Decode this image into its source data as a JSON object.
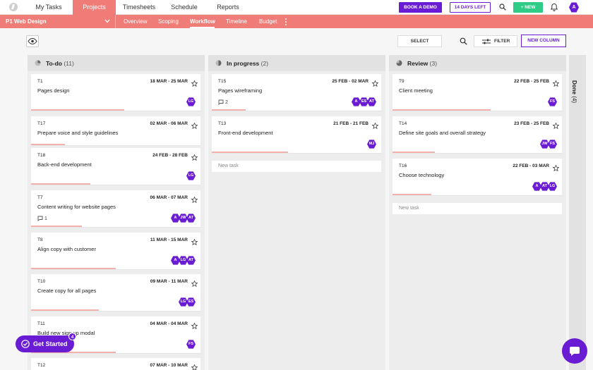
{
  "topnav": {
    "tabs": [
      "My Tasks",
      "Projects",
      "Timesheets",
      "Schedule",
      "Reports"
    ],
    "active_tab": "Projects",
    "demo_label": "BOOK A DEMO",
    "trial_label": "14 DAYS LEFT",
    "new_label": "+ NEW",
    "avatar_initial": "A"
  },
  "subnav": {
    "project_name": "P1 Web Design",
    "tabs": [
      "Overview",
      "Scoping",
      "Workflow",
      "Timeline",
      "Budget"
    ],
    "active_tab": "Workflow"
  },
  "toolbar": {
    "select_label": "SELECT",
    "filter_label": "FILTER",
    "new_column_label": "NEW COLUMN"
  },
  "colors": {
    "accent": "#6a1cd4",
    "brand_coral": "#f07c78",
    "new_green": "#2ecc87"
  },
  "columns": [
    {
      "title": "To-do",
      "count": "(11)",
      "cards": [
        {
          "id": "T1",
          "dates": "18 MAR - 25 MAR",
          "title": "Pages design",
          "comments": "",
          "avatars": [
            "LG"
          ],
          "progress": 0.55
        },
        {
          "id": "T17",
          "dates": "02 MAR - 06 MAR",
          "title": "Prepare voice and style guidelines",
          "comments": "",
          "avatars": [],
          "progress": 0.2
        },
        {
          "id": "T18",
          "dates": "24 FEB - 28 FEB",
          "title": "Back-end development",
          "comments": "",
          "avatars": [
            "LG"
          ],
          "progress": 0.35
        },
        {
          "id": "T7",
          "dates": "06 MAR - 07 MAR",
          "title": "Content writing for website pages",
          "comments": "1",
          "avatars": [
            "A",
            "JW",
            "AT"
          ],
          "progress": 0.3
        },
        {
          "id": "T8",
          "dates": "11 MAR - 15 MAR",
          "title": "Align copy with customer",
          "comments": "",
          "avatars": [
            "A",
            "LG",
            "AT"
          ],
          "progress": 0.5
        },
        {
          "id": "T10",
          "dates": "09 MAR - 11 MAR",
          "title": "Create copy for all pages",
          "comments": "",
          "avatars": [
            "LG",
            "ES"
          ],
          "progress": 0.4
        },
        {
          "id": "T11",
          "dates": "04 MAR - 04 MAR",
          "title": "Build new sign up modal",
          "comments": "",
          "avatars": [
            "FS"
          ],
          "progress": 0.5
        },
        {
          "id": "T12",
          "dates": "07 MAR - 10 MAR",
          "title": "",
          "comments": "",
          "avatars": [],
          "progress": 0
        }
      ]
    },
    {
      "title": "In progress",
      "count": "(2)",
      "cards": [
        {
          "id": "T15",
          "dates": "25 FEB - 02 MAR",
          "title": "Pages wireframing",
          "comments": "2",
          "avatars": [
            "A",
            "ES",
            "AT"
          ],
          "progress": 0.2
        },
        {
          "id": "T13",
          "dates": "21 FEB - 21 FEB",
          "title": "Front-end development",
          "comments": "",
          "avatars": [
            "MJ"
          ],
          "progress": 0.45
        }
      ],
      "new_task_label": "New task"
    },
    {
      "title": "Review",
      "count": "(3)",
      "cards": [
        {
          "id": "T9",
          "dates": "22 FEB - 25 FEB",
          "title": "Client meeting",
          "comments": "",
          "avatars": [
            "FS"
          ],
          "progress": 0.58
        },
        {
          "id": "T14",
          "dates": "23 FEB - 25 FEB",
          "title": "Define site goals and overall strategy",
          "comments": "",
          "avatars": [
            "JW",
            "FS"
          ],
          "progress": 0.25
        },
        {
          "id": "T16",
          "dates": "22 FEB - 03 MAR",
          "title": "Choose technology",
          "comments": "",
          "avatars": [
            "A",
            "AT",
            "LG"
          ],
          "progress": 0.23
        }
      ],
      "new_task_label": "New task"
    }
  ],
  "done_column": {
    "title": "Done",
    "count": "(4)"
  },
  "get_started": {
    "label": "Get Started",
    "badge": "4"
  },
  "icons": [
    "logo-icon",
    "search-icon",
    "bell-icon",
    "chevron-down-icon",
    "eye-icon",
    "filter-icon",
    "star-icon",
    "comment-icon",
    "check-icon",
    "chat-icon"
  ]
}
